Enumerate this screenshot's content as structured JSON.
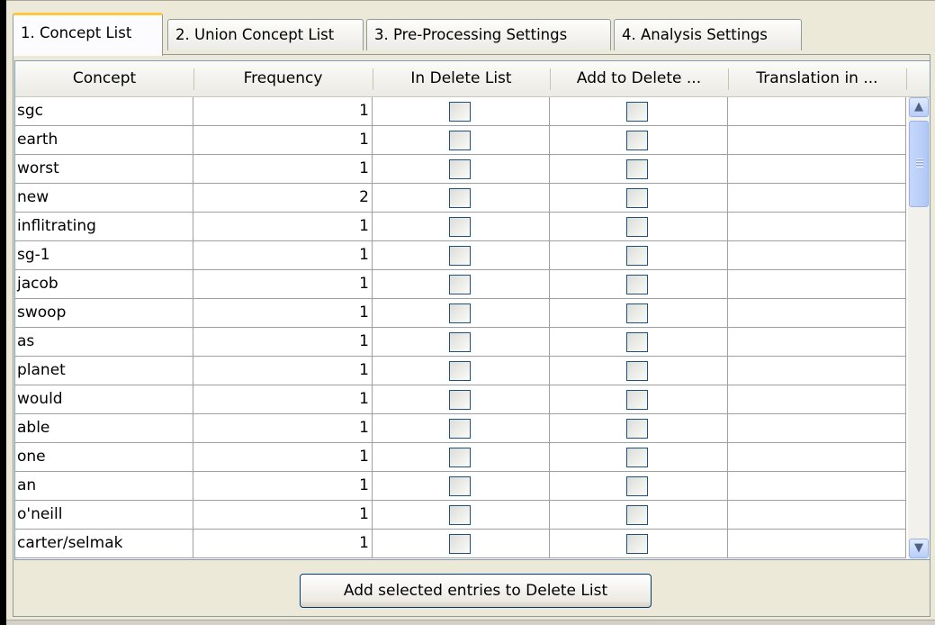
{
  "tabs": [
    {
      "label": "1. Concept List",
      "active": true
    },
    {
      "label": "2. Union Concept List",
      "active": false
    },
    {
      "label": "3. Pre-Processing Settings",
      "active": false
    },
    {
      "label": "4. Analysis Settings",
      "active": false
    }
  ],
  "table": {
    "columns": [
      "Concept",
      "Frequency",
      "In Delete List",
      "Add to Delete ...",
      "Translation in ..."
    ],
    "rows": [
      {
        "concept": "sgc",
        "frequency": "1",
        "in_delete_list": false,
        "add_to_delete": false,
        "translation": ""
      },
      {
        "concept": "earth",
        "frequency": "1",
        "in_delete_list": false,
        "add_to_delete": false,
        "translation": ""
      },
      {
        "concept": "worst",
        "frequency": "1",
        "in_delete_list": false,
        "add_to_delete": false,
        "translation": ""
      },
      {
        "concept": "new",
        "frequency": "2",
        "in_delete_list": false,
        "add_to_delete": false,
        "translation": ""
      },
      {
        "concept": "inflitrating",
        "frequency": "1",
        "in_delete_list": false,
        "add_to_delete": false,
        "translation": ""
      },
      {
        "concept": "sg-1",
        "frequency": "1",
        "in_delete_list": false,
        "add_to_delete": false,
        "translation": ""
      },
      {
        "concept": "jacob",
        "frequency": "1",
        "in_delete_list": false,
        "add_to_delete": false,
        "translation": ""
      },
      {
        "concept": "swoop",
        "frequency": "1",
        "in_delete_list": false,
        "add_to_delete": false,
        "translation": ""
      },
      {
        "concept": "as",
        "frequency": "1",
        "in_delete_list": false,
        "add_to_delete": false,
        "translation": ""
      },
      {
        "concept": "planet",
        "frequency": "1",
        "in_delete_list": false,
        "add_to_delete": false,
        "translation": ""
      },
      {
        "concept": "would",
        "frequency": "1",
        "in_delete_list": false,
        "add_to_delete": false,
        "translation": ""
      },
      {
        "concept": "able",
        "frequency": "1",
        "in_delete_list": false,
        "add_to_delete": false,
        "translation": ""
      },
      {
        "concept": "one",
        "frequency": "1",
        "in_delete_list": false,
        "add_to_delete": false,
        "translation": ""
      },
      {
        "concept": "an",
        "frequency": "1",
        "in_delete_list": false,
        "add_to_delete": false,
        "translation": ""
      },
      {
        "concept": "o'neill",
        "frequency": "1",
        "in_delete_list": false,
        "add_to_delete": false,
        "translation": ""
      },
      {
        "concept": "carter/selmak",
        "frequency": "1",
        "in_delete_list": false,
        "add_to_delete": false,
        "translation": ""
      }
    ]
  },
  "scrollbar": {
    "up_icon": "arrow-up-icon",
    "down_icon": "arrow-down-icon"
  },
  "actions": {
    "add_selected_label": "Add selected entries to Delete List"
  },
  "colors": {
    "active_tab_accent": "#ffc83c",
    "panel_background": "#ece9d8",
    "checkbox_border": "#1c5180"
  }
}
